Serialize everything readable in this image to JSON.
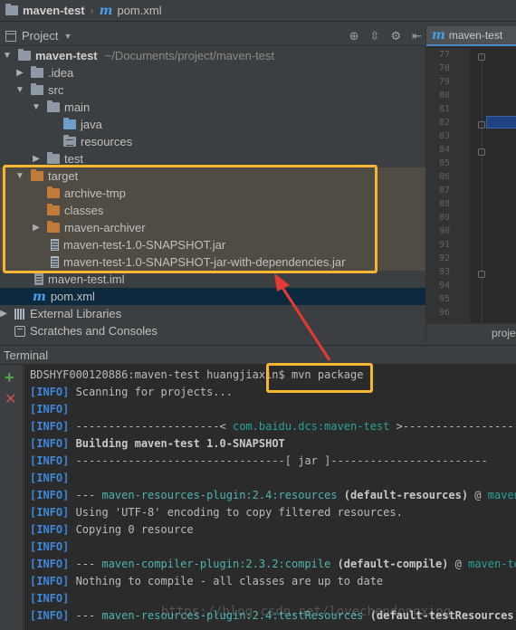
{
  "breadcrumb": {
    "project": "maven-test",
    "file": "pom.xml"
  },
  "project_panel": {
    "title": "Project"
  },
  "tree": {
    "root": {
      "name": "maven-test",
      "path": "~/Documents/project/maven-test"
    },
    "idea": ".idea",
    "src": "src",
    "main": "main",
    "java": "java",
    "resources": "resources",
    "test": "test",
    "target": "target",
    "archive_tmp": "archive-tmp",
    "classes": "classes",
    "maven_archiver": "maven-archiver",
    "jar1": "maven-test-1.0-SNAPSHOT.jar",
    "jar2": "maven-test-1.0-SNAPSHOT-jar-with-dependencies.jar",
    "iml": "maven-test.iml",
    "pom": "pom.xml",
    "external_libraries": "External Libraries",
    "scratches": "Scratches and Consoles"
  },
  "editor": {
    "tab": "maven-test",
    "line_numbers": [
      "77",
      "78",
      "79",
      "80",
      "81",
      "82",
      "83",
      "84",
      "85",
      "86",
      "87",
      "88",
      "89",
      "90",
      "91",
      "92",
      "93",
      "94",
      "95",
      "96"
    ],
    "footer": "proje"
  },
  "terminal": {
    "title": "Terminal",
    "prompt": "BDSHYF000120886:maven-test huangjiaxin$ mvn package",
    "tag": "[INFO]",
    "l1": " Scanning for projects...",
    "l3a": " ----------------------< ",
    "l3b": "com.baidu.dcs:maven-test",
    "l3c": " >-----------------------",
    "l4": " Building maven-test 1.0-SNAPSHOT",
    "l5": " --------------------------------[ jar ]------------------------",
    "l7a": " --- ",
    "l7b": "maven-resources-plugin:2.4:resources",
    "l7c": " (default-resources)",
    "l7d": " @ ",
    "l7e": "maven-test",
    "l8": " Using 'UTF-8' encoding to copy filtered resources.",
    "l9": " Copying 0 resource",
    "l11a": " --- ",
    "l11b": "maven-compiler-plugin:2.3.2:compile",
    "l11c": " (default-compile)",
    "l11d": " @ ",
    "l11e": "maven-test",
    "l12": " Nothing to compile - all classes are up to date",
    "l14a": " --- ",
    "l14b": "maven-resources-plugin:2.4:testResources",
    "l14c": " (default-testResources)",
    "l14d": " @"
  },
  "watermark": "https://blog.csdn.net/lovechendongxing",
  "colors": {
    "highlight": "#f7b733",
    "arrow": "#e53935",
    "info": "#3f87d8"
  }
}
